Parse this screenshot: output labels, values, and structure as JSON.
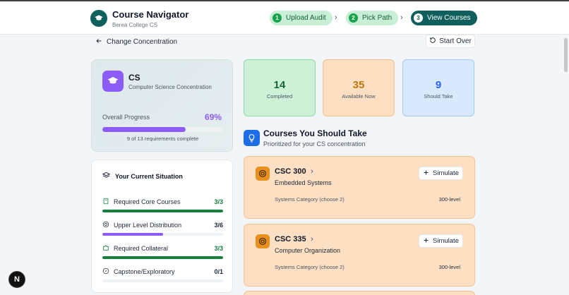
{
  "header": {
    "app_title": "Course Navigator",
    "app_subtitle": "Berea College CS",
    "steps": [
      {
        "num": "1",
        "label": "Upload Audit",
        "state": "done"
      },
      {
        "num": "2",
        "label": "Pick Path",
        "state": "done"
      },
      {
        "num": "3",
        "label": "View Courses",
        "state": "active"
      }
    ]
  },
  "nav": {
    "back_label": "Change Concentration",
    "start_over_label": "Start Over"
  },
  "concentration": {
    "code": "CS",
    "name": "Computer Science Concentration",
    "progress_label": "Overall Progress",
    "progress_percent": "69%",
    "progress_fraction": 0.69,
    "progress_note": "9 of 13 requirements complete"
  },
  "situation": {
    "title": "Your Current Situation",
    "items": [
      {
        "label": "Required Core Courses",
        "value": "3/3",
        "fraction": 1.0,
        "color": "#15803d"
      },
      {
        "label": "Upper Level Distribution",
        "value": "3/6",
        "fraction": 0.5,
        "color": "#8b5cf6"
      },
      {
        "label": "Required Collateral",
        "value": "3/3",
        "fraction": 1.0,
        "color": "#15803d"
      },
      {
        "label": "Capstone/Exploratory",
        "value": "0/1",
        "fraction": 0.0,
        "color": "#9ca3af"
      }
    ]
  },
  "stats": [
    {
      "number": "14",
      "label": "Completed",
      "color": "#166534"
    },
    {
      "number": "35",
      "label": "Available Now",
      "color": "#c2760b"
    },
    {
      "number": "9",
      "label": "Should Take",
      "color": "#2563eb"
    }
  ],
  "recommend": {
    "title": "Courses You Should Take",
    "subtitle": "Prioritized for your CS concentration",
    "simulate_label": "Simulate",
    "courses": [
      {
        "code": "CSC 300",
        "name": "Embedded Systems",
        "category": "Systems Category (choose 2)",
        "level": "300-level"
      },
      {
        "code": "CSC 335",
        "name": "Computer Organization",
        "category": "Systems Category (choose 2)",
        "level": "300-level"
      }
    ]
  },
  "fab_label": "N",
  "colors": {
    "brand": "#0f5f5c",
    "accent": "#8b5cf6",
    "success": "#16a34a",
    "warning": "#e8901c",
    "info": "#1d6ee6"
  }
}
